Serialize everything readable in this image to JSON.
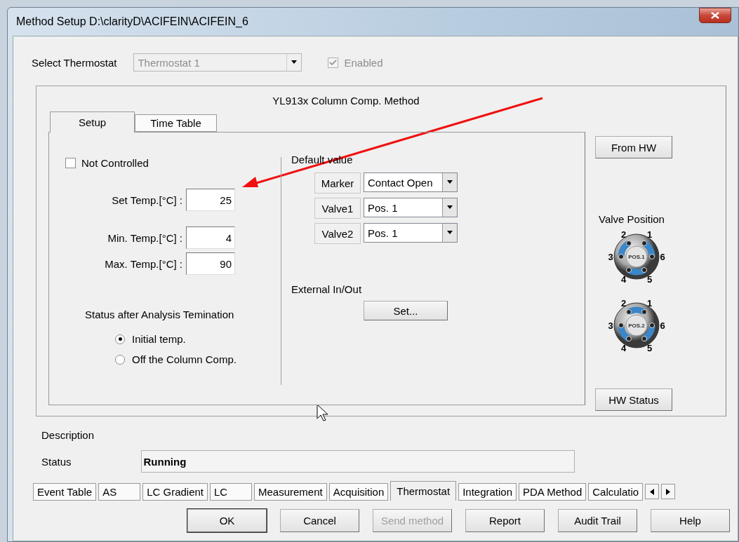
{
  "window": {
    "title": "Method Setup D:\\clarityD\\ACIFEIN\\ACIFEIN_6"
  },
  "thermostat": {
    "label": "Select Thermostat",
    "value": "Thermostat 1",
    "disabled": true,
    "enabled": {
      "label": "Enabled",
      "checked": true,
      "disabled": true
    }
  },
  "group_title": "YL913x Column Comp. Method",
  "tabs": [
    {
      "label": "Setup",
      "selected": true
    },
    {
      "label": "Time Table",
      "selected": false
    }
  ],
  "setup": {
    "not_controlled": {
      "label": "Not Controlled",
      "checked": false
    },
    "temps": [
      {
        "label": "Set Temp.[°C] :",
        "value": "25"
      },
      {
        "label": "Min. Temp.[°C] :",
        "value": "4"
      },
      {
        "label": "Max. Temp.[°C] :",
        "value": "90"
      }
    ],
    "status_after": {
      "title": "Status after Analysis Temination",
      "options": [
        {
          "label": "Initial temp.",
          "selected": true
        },
        {
          "label": "Off the Column Comp.",
          "selected": false
        }
      ]
    },
    "default_value": {
      "title": "Default value",
      "rows": [
        {
          "label": "Marker",
          "value": "Contact Open"
        },
        {
          "label": "Valve1",
          "value": "Pos. 1"
        },
        {
          "label": "Valve2",
          "value": "Pos. 1"
        }
      ]
    },
    "external": {
      "title": "External In/Out",
      "button": "Set..."
    }
  },
  "from_hw": "From HW",
  "valve_position": {
    "title": "Valve Position",
    "valves": [
      {
        "kind": "pos1",
        "label": "POS.1",
        "ports": [
          "1",
          "2",
          "3",
          "4",
          "5",
          "6"
        ]
      },
      {
        "kind": "pos2",
        "label": "POS.2",
        "ports": [
          "1",
          "2",
          "3",
          "4",
          "5",
          "6"
        ]
      }
    ]
  },
  "hw_status": "HW Status",
  "description": {
    "label": "Description"
  },
  "status": {
    "label": "Status",
    "value": "Running"
  },
  "method_tabs": [
    {
      "label": "Event Table",
      "selected": false
    },
    {
      "label": "AS",
      "selected": false
    },
    {
      "label": "LC Gradient",
      "selected": false
    },
    {
      "label": "LC",
      "selected": false
    },
    {
      "label": "Measurement",
      "selected": false
    },
    {
      "label": "Acquisition",
      "selected": false
    },
    {
      "label": "Thermostat",
      "selected": true
    },
    {
      "label": "Integration",
      "selected": false
    },
    {
      "label": "PDA Method",
      "selected": false
    },
    {
      "label": "Calculatio",
      "selected": false
    }
  ],
  "buttons": [
    {
      "label": "OK",
      "disabled": false,
      "default": true
    },
    {
      "label": "Cancel",
      "disabled": false,
      "default": false
    },
    {
      "label": "Send method",
      "disabled": true,
      "default": false
    },
    {
      "label": "Report",
      "disabled": false,
      "default": false
    },
    {
      "label": "Audit Trail",
      "disabled": false,
      "default": false
    },
    {
      "label": "Help",
      "disabled": false,
      "default": false
    }
  ]
}
